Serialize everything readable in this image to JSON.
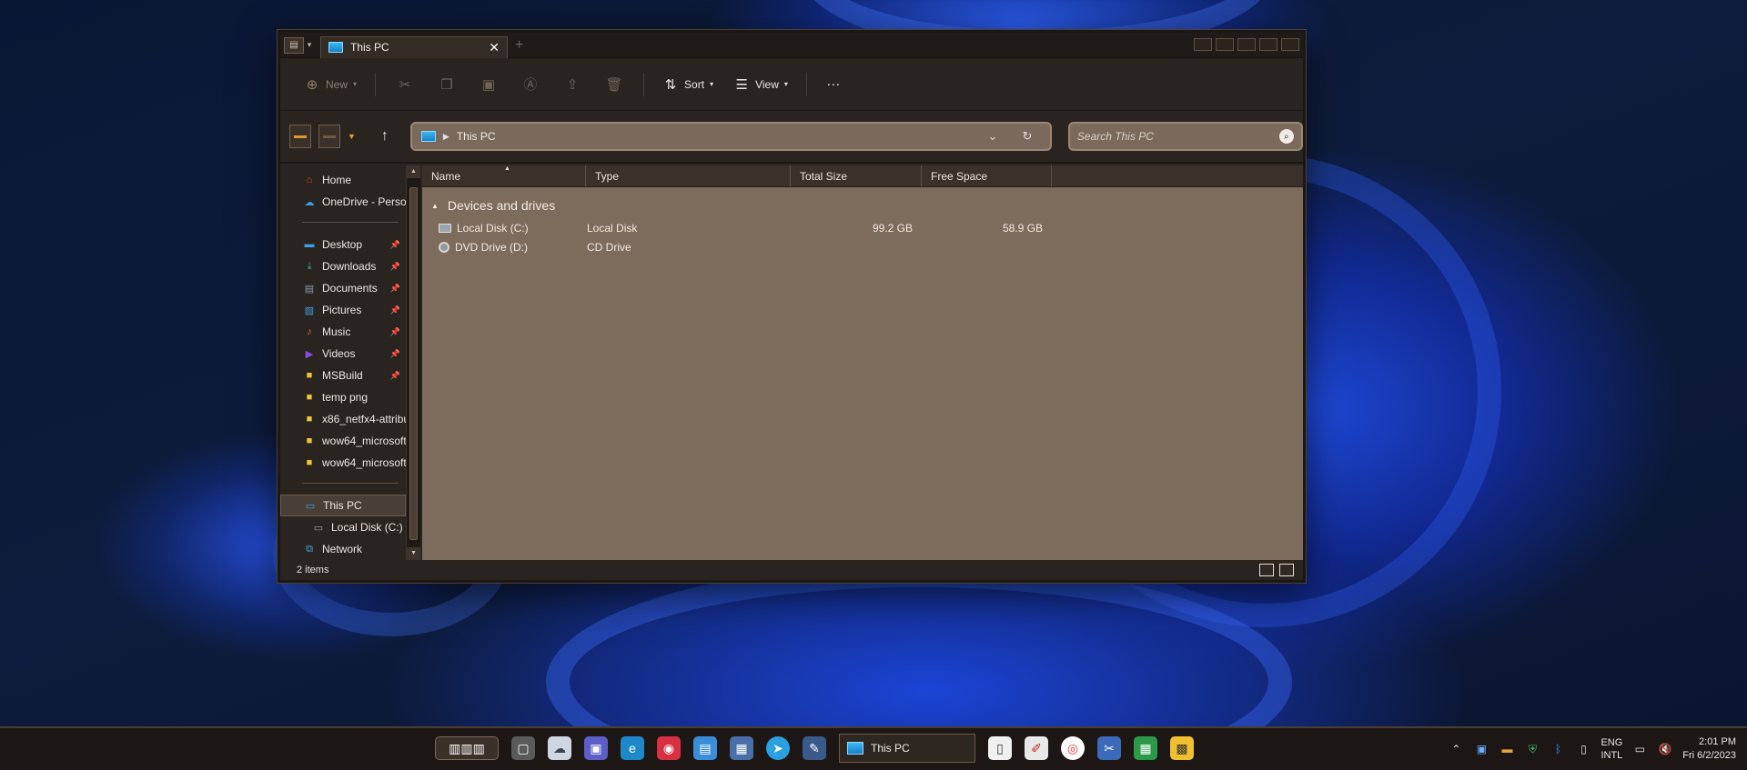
{
  "window": {
    "tab_title": "This PC",
    "tab_close": "✕",
    "new_tab": "+"
  },
  "commandbar": {
    "new_label": "New",
    "sort_label": "Sort",
    "view_label": "View",
    "more_label": "···"
  },
  "address": {
    "path": "This PC",
    "search_placeholder": "Search This PC"
  },
  "sidebar": {
    "quick": [
      {
        "label": "Home",
        "icon": "home-icon",
        "color": "#e04a3a"
      },
      {
        "label": "OneDrive - Personal",
        "icon": "onedrive-icon",
        "color": "#3a9ee8"
      }
    ],
    "pinned": [
      {
        "label": "Desktop",
        "icon": "desktop-icon",
        "color": "#3aa0e8"
      },
      {
        "label": "Downloads",
        "icon": "download-icon",
        "color": "#3ab86a"
      },
      {
        "label": "Documents",
        "icon": "document-icon",
        "color": "#8a9aaa"
      },
      {
        "label": "Pictures",
        "icon": "pictures-icon",
        "color": "#3a9ee8"
      },
      {
        "label": "Music",
        "icon": "music-icon",
        "color": "#e86a3a"
      },
      {
        "label": "Videos",
        "icon": "videos-icon",
        "color": "#8a4ae8"
      },
      {
        "label": "MSBuild",
        "icon": "folder-icon",
        "color": "#f0c23a"
      },
      {
        "label": "temp png",
        "icon": "folder-icon",
        "color": "#f0c23a"
      },
      {
        "label": "x86_netfx4-attribu",
        "icon": "folder-icon",
        "color": "#f0c23a"
      },
      {
        "label": "wow64_microsoft",
        "icon": "folder-icon",
        "color": "#f0c23a"
      },
      {
        "label": "wow64_microsoft",
        "icon": "folder-icon",
        "color": "#f0c23a"
      }
    ],
    "this_pc": "This PC",
    "local_disk": "Local Disk (C:)",
    "network": "Network"
  },
  "content": {
    "columns": [
      "Name",
      "Type",
      "Total Size",
      "Free Space"
    ],
    "group": "Devices and drives",
    "rows": [
      {
        "name": "Local Disk (C:)",
        "type": "Local Disk",
        "total": "99.2 GB",
        "free": "58.9 GB"
      },
      {
        "name": "DVD Drive (D:)",
        "type": "CD Drive",
        "total": "",
        "free": ""
      }
    ]
  },
  "status": {
    "items": "2 items"
  },
  "taskbar": {
    "app_label": "This PC",
    "lang_line1": "ENG",
    "lang_line2": "INTL",
    "time": "2:01 PM",
    "date": "Fri 6/2/2023"
  }
}
